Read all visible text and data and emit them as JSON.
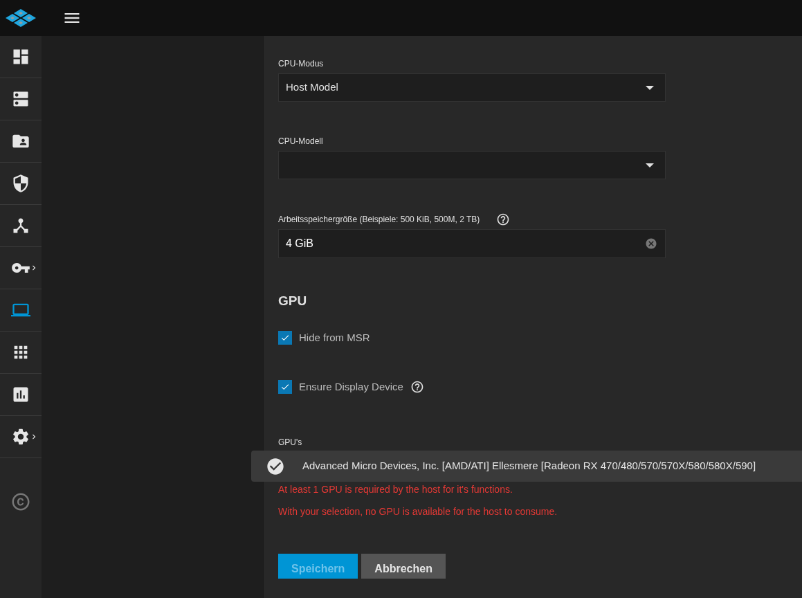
{
  "sidebar": {
    "items": [
      {
        "selected": false,
        "expandable": false
      },
      {
        "selected": false,
        "expandable": false
      },
      {
        "selected": false,
        "expandable": false
      },
      {
        "selected": false,
        "expandable": false
      },
      {
        "selected": false,
        "expandable": false
      },
      {
        "selected": false,
        "expandable": true
      },
      {
        "selected": true,
        "expandable": false
      },
      {
        "selected": false,
        "expandable": false
      },
      {
        "selected": false,
        "expandable": false
      },
      {
        "selected": false,
        "expandable": true
      }
    ]
  },
  "form": {
    "cpu_mode": {
      "label": "CPU-Modus",
      "value": "Host Model"
    },
    "cpu_model": {
      "label": "CPU-Modell"
    },
    "memory": {
      "label": "Arbeitsspeichergröße (Beispiele: 500 KiB, 500M, 2 TB)",
      "value": "4 GiB"
    },
    "gpu_heading": "GPU",
    "checkboxes": [
      {
        "label": "Hide from MSR",
        "checked": true,
        "help": false
      },
      {
        "label": "Ensure Display Device",
        "checked": true,
        "help": true
      }
    ],
    "gpus_label": "GPU's",
    "gpu_options": [
      {
        "label": "Advanced Micro Devices, Inc. [AMD/ATI] Ellesmere [Radeon RX 470/480/570/570X/580/580X/590]",
        "selected": true
      }
    ],
    "errors": [
      "At least 1 GPU is required by the host for it's functions.",
      "With your selection, no GPU is available for the host to consume."
    ],
    "buttons": [
      {
        "label": "Speichern",
        "kind": "primary",
        "disabled": true
      },
      {
        "label": "Abbrechen",
        "kind": "secondary",
        "disabled": false
      }
    ]
  }
}
